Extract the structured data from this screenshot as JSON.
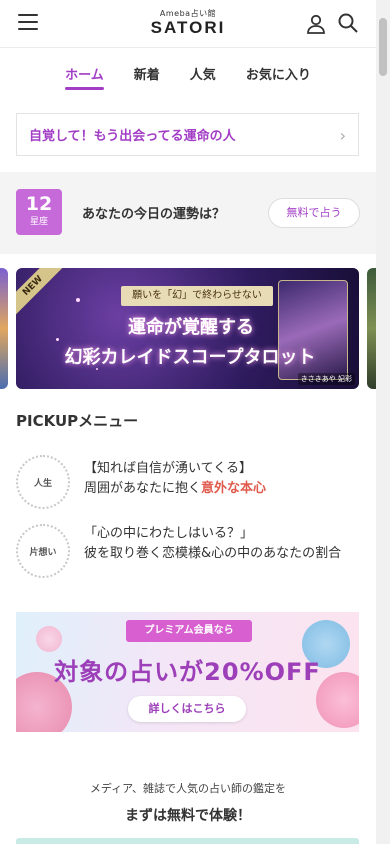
{
  "header": {
    "logo_sub": "Ameba占い館",
    "logo_main": "SATORI",
    "menu_icon": "hamburger-menu-icon",
    "user_icon": "user-icon",
    "search_icon": "search-icon"
  },
  "tabs": [
    {
      "label": "ホーム",
      "active": true
    },
    {
      "label": "新着",
      "active": false
    },
    {
      "label": "人気",
      "active": false
    },
    {
      "label": "お気に入り",
      "active": false
    }
  ],
  "topic_banner": {
    "text": "自覚して！もう出会ってる運命の人"
  },
  "daily_fortune": {
    "sign_number": "12",
    "sign_label": "星座",
    "question": "あなたの今日の運勢は？",
    "button_label": "無料で占う"
  },
  "featured_banner": {
    "badge": "NEW",
    "tagline": "願いを「幻」で終わらせない",
    "line1": "運命が覚醒する",
    "line2": "幻彩カレイドスコープタロット",
    "author": "きさきあや 妃彩"
  },
  "pickup": {
    "title": "PICKUPメニュー",
    "items": [
      {
        "badge": "人生",
        "line1": "【知れば自信が湧いてくる】",
        "line2_plain": "周囲があなたに抱く",
        "line2_accent": "意外な本心"
      },
      {
        "badge": "片想い",
        "line1": "「心の中にわたしはいる？」",
        "line2": "彼を取り巻く恋模様&心の中のあなたの割合"
      }
    ]
  },
  "premium_banner": {
    "ribbon": "プレミアム会員なら",
    "headline": "対象の占いが20%OFF",
    "button_label": "詳しくはこちら"
  },
  "promo": {
    "subtitle": "メディア、雑誌で人気の占い師の鑑定を",
    "title": "まずは無料で体験！"
  },
  "colors": {
    "accent": "#a23ec6",
    "highlight": "#e05b4d",
    "sign_bg": "#c66ad9"
  }
}
